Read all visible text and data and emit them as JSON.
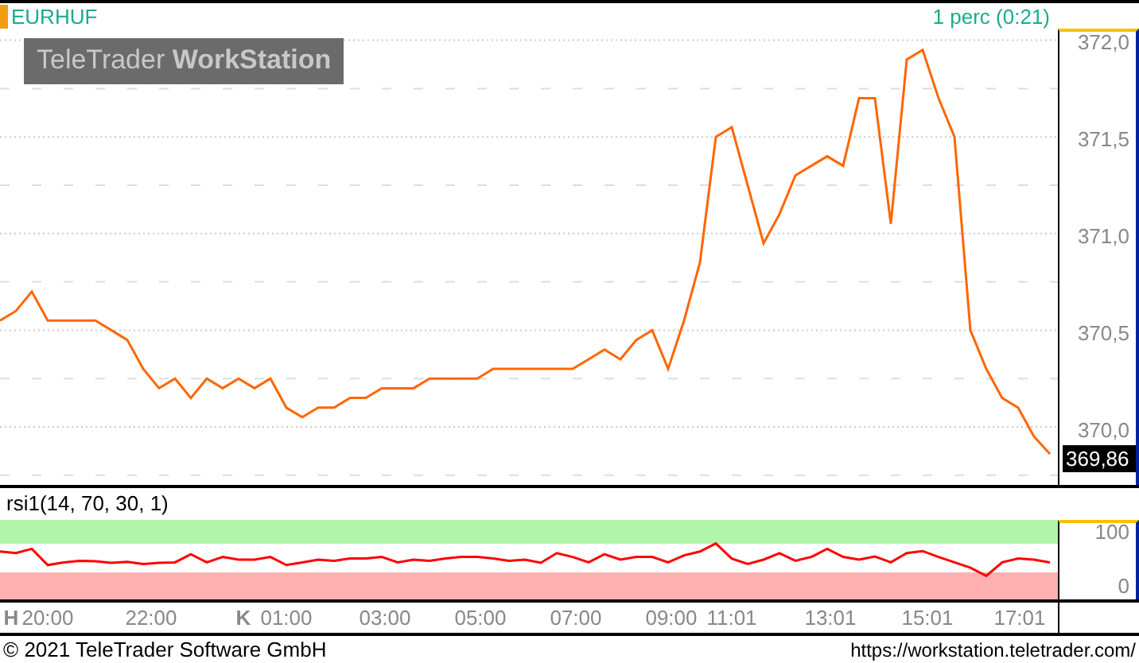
{
  "header": {
    "symbol": "EURHUF",
    "interval": "1 perc (0:21)"
  },
  "logo": {
    "light": "TeleTrader",
    "bold": "WorkStation"
  },
  "price_panel": {
    "last_price": "369,86",
    "chart_data": {
      "type": "line",
      "ylim": [
        369.7,
        372.06
      ],
      "grid": true,
      "yticks": [
        {
          "value": 370,
          "label": "370,0"
        },
        {
          "value": 370.5,
          "label": "370,5"
        },
        {
          "value": 371,
          "label": "371,0"
        },
        {
          "value": 371.5,
          "label": "371,5"
        },
        {
          "value": 372,
          "label": "372,0"
        }
      ],
      "series": [
        {
          "color": "#ff6600",
          "values": [
            370.55,
            370.6,
            370.7,
            370.55,
            370.55,
            370.55,
            370.55,
            370.5,
            370.45,
            370.3,
            370.2,
            370.25,
            370.15,
            370.25,
            370.2,
            370.25,
            370.2,
            370.25,
            370.1,
            370.05,
            370.1,
            370.1,
            370.15,
            370.15,
            370.2,
            370.2,
            370.2,
            370.25,
            370.25,
            370.25,
            370.25,
            370.3,
            370.3,
            370.3,
            370.3,
            370.3,
            370.3,
            370.35,
            370.4,
            370.35,
            370.45,
            370.5,
            370.3,
            370.55,
            370.85,
            371.5,
            371.55,
            371.25,
            370.95,
            371.1,
            371.3,
            371.35,
            371.4,
            371.35,
            371.7,
            371.7,
            371.05,
            371.9,
            371.95,
            371.7,
            371.5,
            370.5,
            370.3,
            370.15,
            370.1,
            369.95,
            369.86
          ]
        }
      ]
    }
  },
  "rsi_panel": {
    "title": "rsi1(14, 70, 30, 1)",
    "chart_data": {
      "type": "line",
      "ylim": [
        -23.5,
        123.5
      ],
      "yticks": [
        {
          "value": 100,
          "label": "100"
        },
        {
          "value": 0,
          "label": "0"
        }
      ],
      "series": [
        {
          "color": "#ff0000",
          "values": [
            65,
            62,
            70,
            40,
            45,
            48,
            47,
            44,
            46,
            42,
            44,
            45,
            60,
            45,
            55,
            50,
            50,
            55,
            40,
            45,
            50,
            48,
            52,
            52,
            55,
            45,
            50,
            48,
            52,
            55,
            55,
            52,
            48,
            50,
            44,
            62,
            55,
            45,
            60,
            50,
            55,
            55,
            45,
            58,
            65,
            80,
            52,
            42,
            50,
            62,
            48,
            55,
            70,
            55,
            50,
            56,
            45,
            62,
            66,
            55,
            45,
            35,
            20,
            45,
            52,
            50,
            45
          ]
        }
      ]
    }
  },
  "time_axis": [
    {
      "label": "H",
      "kind": "day"
    },
    {
      "label": "20:00",
      "kind": "time"
    },
    {
      "label": "22:00",
      "kind": "time"
    },
    {
      "label": "K",
      "kind": "day"
    },
    {
      "label": "01:00",
      "kind": "time"
    },
    {
      "label": "03:00",
      "kind": "time"
    },
    {
      "label": "05:00",
      "kind": "time"
    },
    {
      "label": "07:00",
      "kind": "time"
    },
    {
      "label": "09:00",
      "kind": "time"
    },
    {
      "label": "11:01",
      "kind": "time"
    },
    {
      "label": "13:01",
      "kind": "time"
    },
    {
      "label": "15:01",
      "kind": "time"
    },
    {
      "label": "17:01",
      "kind": "time"
    }
  ],
  "footer": {
    "copyright": "© 2021 TeleTrader Software GmbH",
    "url": "https://workstation.teletrader.com/"
  }
}
